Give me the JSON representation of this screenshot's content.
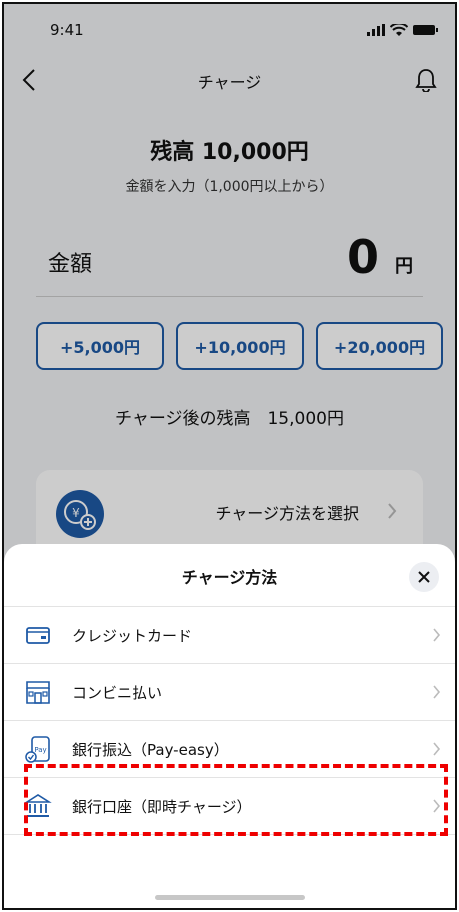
{
  "status": {
    "time": "9:41"
  },
  "nav": {
    "title": "チャージ"
  },
  "balance": {
    "title": "残高 10,000円",
    "hint": "金額を入力（1,000円以上から）",
    "amount_label": "金額",
    "amount_value": "0",
    "amount_unit": "円"
  },
  "quick_amounts": [
    "+5,000円",
    "+10,000円",
    "+20,000円"
  ],
  "after_balance": "チャージ後の残高　15,000円",
  "method_select": {
    "label": "チャージ方法を選択"
  },
  "sheet": {
    "title": "チャージ方法",
    "items": [
      {
        "label": "クレジットカード",
        "icon": "credit-card-icon"
      },
      {
        "label": "コンビニ払い",
        "icon": "convenience-store-icon"
      },
      {
        "label": "銀行振込（Pay-easy）",
        "icon": "pay-easy-icon"
      },
      {
        "label": "銀行口座（即時チャージ）",
        "icon": "bank-icon"
      }
    ]
  },
  "colors": {
    "accent": "#1f5aa6",
    "highlight": "#e00000"
  }
}
